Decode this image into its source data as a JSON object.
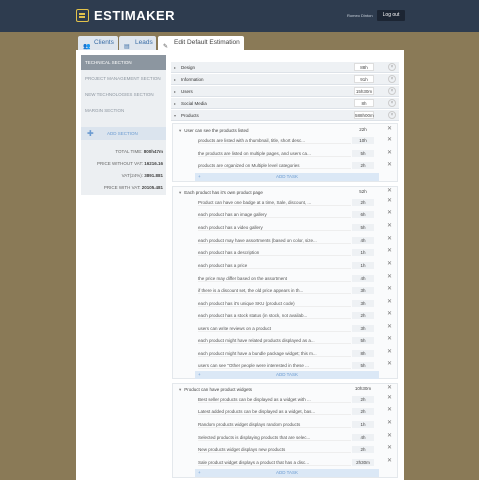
{
  "app": {
    "title": "ESTIMAKER",
    "user_name": "Romeo Dinton",
    "logout_label": "Log out"
  },
  "tabs": [
    {
      "label": "Clients",
      "icon": "users-icon"
    },
    {
      "label": "Leads",
      "icon": "leads-icon"
    },
    {
      "label": "Edit Default Estimation",
      "icon": "edit-icon"
    }
  ],
  "sidebar": {
    "sections": [
      "TECHNICAL SECTION",
      "PROJECT MANAGEMENT SECTION",
      "NEW TECHNOLOGIES SECTION",
      "MARGIN SECTION"
    ],
    "add_label": "ADD SECTION",
    "totals": {
      "total_time_label": "TOTAL TIME:",
      "total_time": "800h47m",
      "price_no_vat_label": "PRICE WITHOUT VAT:",
      "price_no_vat": "16216.16",
      "vat_label": "VAT(24%):",
      "vat": "3891.881",
      "price_vat_label": "PRICE WITH VAT:",
      "price_vat": "20105.481"
    }
  },
  "sections": [
    {
      "name": "Design",
      "duration": "88h"
    },
    {
      "name": "Information",
      "duration": "91h"
    },
    {
      "name": "Users",
      "duration": "15h30m"
    },
    {
      "name": "Social Media",
      "duration": "8h"
    },
    {
      "name": "Products",
      "duration": "588h00m"
    }
  ],
  "add_task_label": "ADD TASK",
  "tasks": [
    {
      "name": "User can see the products listed",
      "duration": "22h",
      "subtasks": [
        {
          "name": "products are listed with a thumbnail, title, short desc...",
          "duration": "10h"
        },
        {
          "name": "the products are listed on multiple pages, and users ca...",
          "duration": "5h"
        },
        {
          "name": "products are organized on Multiple level categories",
          "duration": "2h"
        }
      ]
    },
    {
      "name": "Each product has it's own product page",
      "duration": "52h",
      "subtasks": [
        {
          "name": "Product can have one badge at a time, Sale, discount, ...",
          "duration": "2h"
        },
        {
          "name": "each product has an image gallery",
          "duration": "6h"
        },
        {
          "name": "each product has a video gallery",
          "duration": "5h"
        },
        {
          "name": "each product may have assortments (based on color, size...",
          "duration": "4h"
        },
        {
          "name": "each product has a description",
          "duration": "1h"
        },
        {
          "name": "each product has a price",
          "duration": "1h"
        },
        {
          "name": "the price may differ based on the assortment",
          "duration": "4h"
        },
        {
          "name": "if there is a discount set, the old price appears in th...",
          "duration": "3h"
        },
        {
          "name": "each product has it's unique SKU (product code)",
          "duration": "3h"
        },
        {
          "name": "each product has a stock status (in stock, not availab...",
          "duration": "2h"
        },
        {
          "name": "users can write reviews on a product",
          "duration": "3h"
        },
        {
          "name": "each product might have related products displayed as a...",
          "duration": "5h"
        },
        {
          "name": "each product might have a bundle package widget; this m...",
          "duration": "8h"
        },
        {
          "name": "users can see \"Other people were interested in these ...",
          "duration": "5h"
        }
      ]
    },
    {
      "name": "Product can have product widgets",
      "duration": "10h30m",
      "subtasks": [
        {
          "name": "Best seller products can be displayed as a widget with ...",
          "duration": "2h"
        },
        {
          "name": "Latest added products can be displayed as a widget, bas...",
          "duration": "2h"
        },
        {
          "name": "Random products widget displays random products",
          "duration": "1h"
        },
        {
          "name": "Selected products is displaying products that are selec...",
          "duration": "4h"
        },
        {
          "name": "New products widget displays new products",
          "duration": "2h"
        },
        {
          "name": "Sale product widget displays a product that has a disc...",
          "duration": "2h30m"
        }
      ]
    }
  ]
}
